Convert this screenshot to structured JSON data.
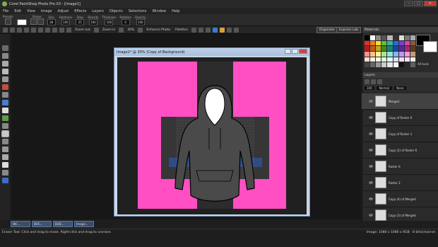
{
  "window": {
    "title": "Corel PaintShop Photo Pro X3 - [Image1]",
    "min": "–",
    "max": "□",
    "close": "✕"
  },
  "menu": [
    "File",
    "Edit",
    "View",
    "Image",
    "Adjust",
    "Effects",
    "Layers",
    "Objects",
    "Selections",
    "Window",
    "Help"
  ],
  "options": {
    "presets_label": "Presets",
    "shape_label": "Shape",
    "size_label": "Size",
    "size_value": "38",
    "hardness_label": "Hardness",
    "hardness_value": "100",
    "step_label": "Step",
    "step_value": "25",
    "density_label": "Density",
    "density_value": "100",
    "thickness_label": "Thickness",
    "thickness_value": "100",
    "rotation_label": "Rotation",
    "rotation_value": "0",
    "opacity_label": "Opacity",
    "opacity_value": "100"
  },
  "toolbar": {
    "zoom_out": "Zoom out",
    "zoom_in": "Zoom in",
    "zoom_value": "30%",
    "enhance": "Enhance Photo",
    "palettes": "Palettes",
    "organizer": "Organizer",
    "express_lab": "Express Lab"
  },
  "image_window": {
    "title": "Image1* @ 30% (Copy of Background)"
  },
  "materials": {
    "title": "Materials",
    "all_tools": "All tools"
  },
  "layers": {
    "title": "Layers",
    "blend": "Normal",
    "opacity": "100",
    "none": "None",
    "rows": [
      {
        "name": "Merged"
      },
      {
        "name": "Copy of Raster 6"
      },
      {
        "name": "Copy of Raster 1"
      },
      {
        "name": "Copy (2) of Raster 6"
      },
      {
        "name": "Raster 6"
      },
      {
        "name": "Raster 2"
      },
      {
        "name": "Copy (4) of Merged"
      },
      {
        "name": "Copy (3) of Merged"
      }
    ]
  },
  "tabs": [
    "NIC...",
    "BOC...",
    "BUD...",
    "Image..."
  ],
  "status": {
    "left": "Eraser Tool: Click and drag to erase. Right-click and drag to unerase.",
    "right": "Image: 1080 x 1080 x RGB - 8 bits/channel"
  }
}
